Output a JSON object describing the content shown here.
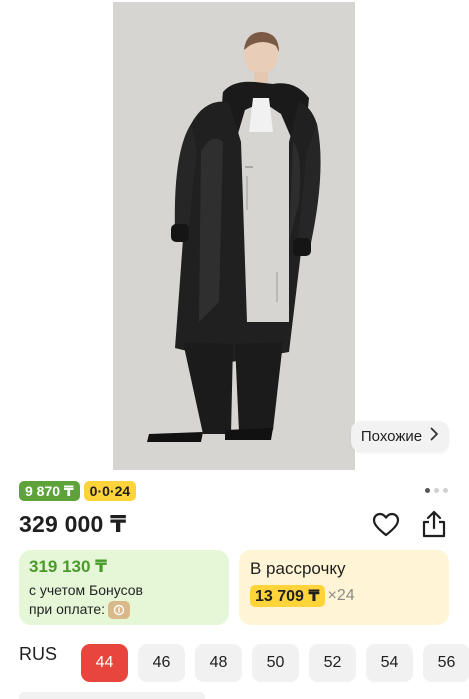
{
  "gallery": {
    "similar_label": "Похожие",
    "page_indicator": {
      "total": 3,
      "active": 0
    }
  },
  "badges": {
    "bonus": "9 870 ₸",
    "installment": "0·0·24"
  },
  "price": "329 000 ₸",
  "bonus_card": {
    "price": "319 130 ₸",
    "line1": "с учетом Бонусов",
    "line2": "при оплате:"
  },
  "install_card": {
    "title": "В рассрочку",
    "amount": "13 709 ₸",
    "count": "×24"
  },
  "sizes": {
    "system": "RUS",
    "options": [
      "44",
      "46",
      "48",
      "50",
      "52",
      "54",
      "56"
    ],
    "selected": "44"
  },
  "colors": {
    "accent_red": "#e8453c",
    "bonus_green": "#5ea33a",
    "install_yellow": "#ffd43b"
  },
  "icons": [
    "heart-icon",
    "share-icon",
    "chevron-right-icon",
    "wallet-icon"
  ]
}
